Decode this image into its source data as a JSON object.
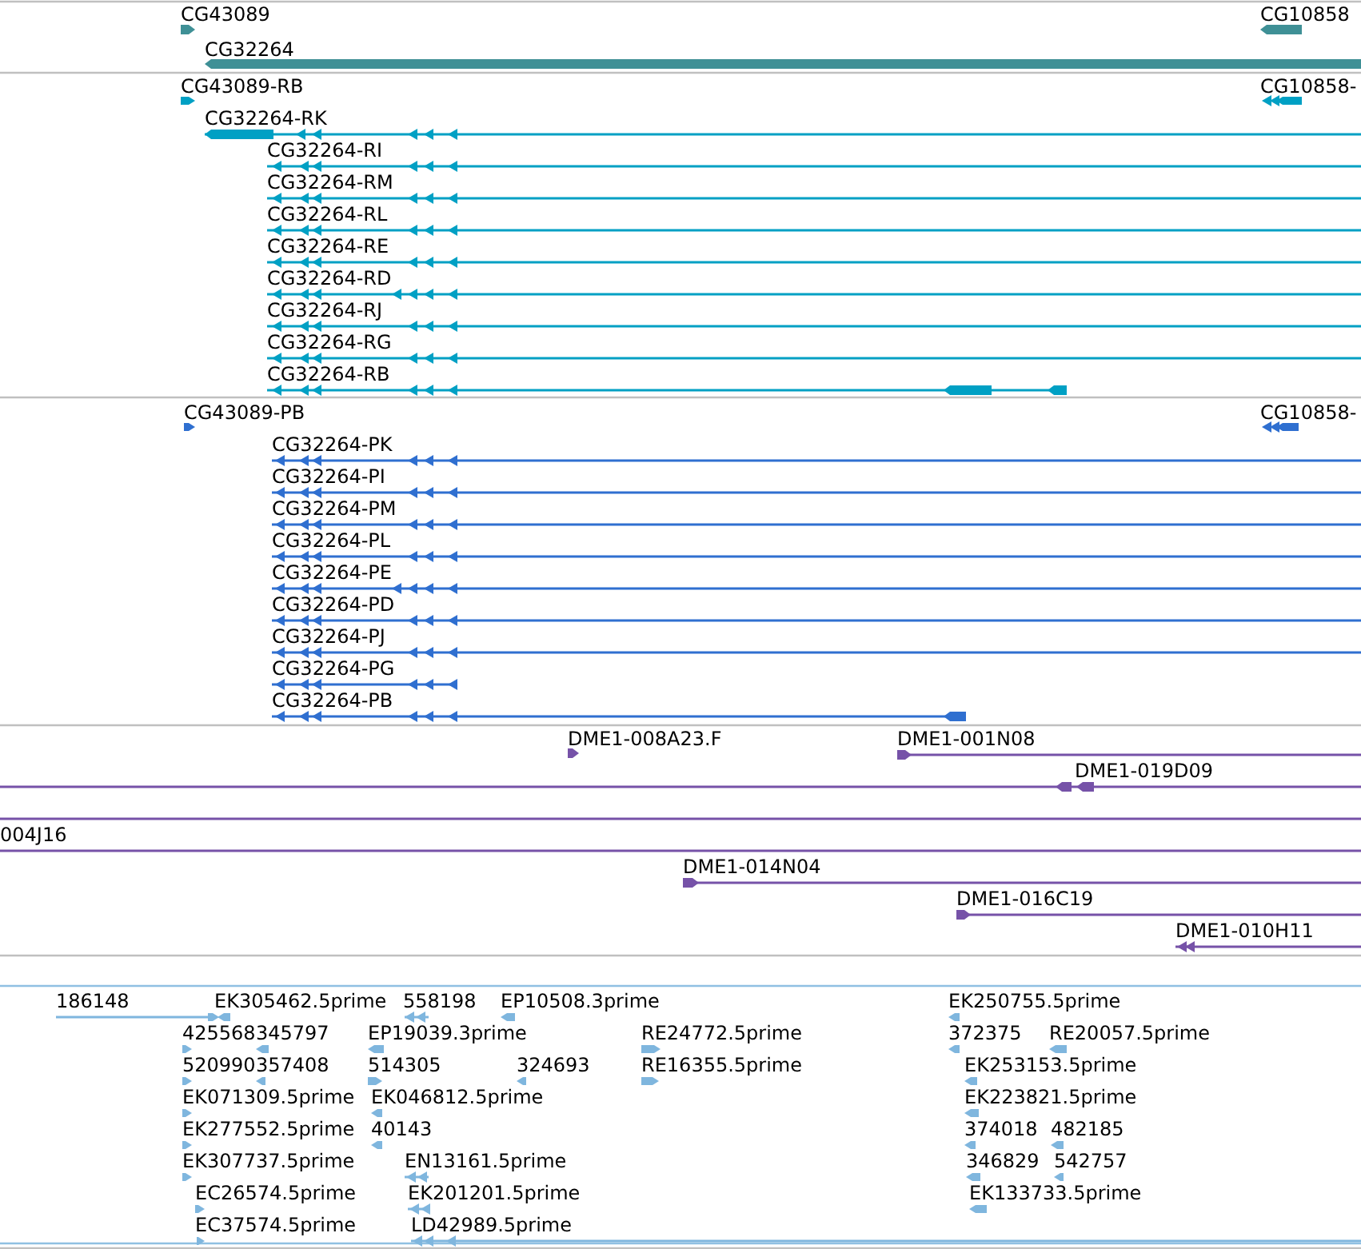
{
  "tracks": [
    {
      "kind": "gene",
      "features": [
        {
          "label": "CG43089",
          "reverse": false
        },
        {
          "label": "CG10858",
          "reverse": true
        },
        {
          "label": "CG32264",
          "reverse": true
        }
      ]
    },
    {
      "kind": "transcript",
      "features": [
        {
          "label": "CG43089-RB",
          "reverse": false
        },
        {
          "label": "CG10858-",
          "reverse": true
        },
        {
          "label": "CG32264-RK",
          "reverse": true
        },
        {
          "label": "CG32264-RI",
          "reverse": true
        },
        {
          "label": "CG32264-RM",
          "reverse": true
        },
        {
          "label": "CG32264-RL",
          "reverse": true
        },
        {
          "label": "CG32264-RE",
          "reverse": true
        },
        {
          "label": "CG32264-RD",
          "reverse": true
        },
        {
          "label": "CG32264-RJ",
          "reverse": true
        },
        {
          "label": "CG32264-RG",
          "reverse": true
        },
        {
          "label": "CG32264-RB",
          "reverse": true
        }
      ]
    },
    {
      "kind": "protein",
      "features": [
        {
          "label": "CG43089-PB",
          "reverse": false
        },
        {
          "label": "CG10858-",
          "reverse": true
        },
        {
          "label": "CG32264-PK",
          "reverse": true
        },
        {
          "label": "CG32264-PI",
          "reverse": true
        },
        {
          "label": "CG32264-PM",
          "reverse": true
        },
        {
          "label": "CG32264-PL",
          "reverse": true
        },
        {
          "label": "CG32264-PE",
          "reverse": true
        },
        {
          "label": "CG32264-PD",
          "reverse": true
        },
        {
          "label": "CG32264-PJ",
          "reverse": true
        },
        {
          "label": "CG32264-PG",
          "reverse": true
        },
        {
          "label": "CG32264-PB",
          "reverse": true
        }
      ]
    },
    {
      "kind": "clone",
      "features": [
        {
          "label": "DME1-008A23.F",
          "reverse": false
        },
        {
          "label": "DME1-001N08",
          "reverse": false
        },
        {
          "label": "DME1-019D09",
          "reverse": true
        },
        {
          "label": "004J16"
        },
        {
          "label": "DME1-014N04",
          "reverse": false
        },
        {
          "label": "DME1-016C19",
          "reverse": false
        },
        {
          "label": "DME1-010H11",
          "reverse": true
        }
      ]
    },
    {
      "kind": "est",
      "features": [
        {
          "label": "186148",
          "reverse": false
        },
        {
          "label": "EK305462.5prime",
          "reverse": true
        },
        {
          "label": "558198",
          "reverse": true
        },
        {
          "label": "EP10508.3prime",
          "reverse": true
        },
        {
          "label": "EK250755.5prime",
          "reverse": true
        },
        {
          "label": "425568",
          "reverse": false
        },
        {
          "label": "345797",
          "reverse": true
        },
        {
          "label": "EP19039.3prime",
          "reverse": true
        },
        {
          "label": "RE24772.5prime",
          "reverse": false
        },
        {
          "label": "372375",
          "reverse": true
        },
        {
          "label": "RE20057.5prime",
          "reverse": true
        },
        {
          "label": "520990",
          "reverse": false
        },
        {
          "label": "357408",
          "reverse": true
        },
        {
          "label": "514305",
          "reverse": false
        },
        {
          "label": "324693",
          "reverse": true
        },
        {
          "label": "RE16355.5prime",
          "reverse": false
        },
        {
          "label": "EK253153.5prime",
          "reverse": true
        },
        {
          "label": "EK071309.5prime",
          "reverse": false
        },
        {
          "label": "EK046812.5prime",
          "reverse": true
        },
        {
          "label": "EK223821.5prime",
          "reverse": true
        },
        {
          "label": "EK277552.5prime",
          "reverse": false
        },
        {
          "label": "40143",
          "reverse": true
        },
        {
          "label": "374018",
          "reverse": true
        },
        {
          "label": "482185",
          "reverse": true
        },
        {
          "label": "EK307737.5prime",
          "reverse": false
        },
        {
          "label": "EN13161.5prime",
          "reverse": true
        },
        {
          "label": "346829",
          "reverse": true
        },
        {
          "label": "542757",
          "reverse": true
        },
        {
          "label": "EC26574.5prime",
          "reverse": false
        },
        {
          "label": "EK201201.5prime",
          "reverse": true
        },
        {
          "label": "EK133733.5prime",
          "reverse": true
        },
        {
          "label": "EC37574.5prime",
          "reverse": false
        },
        {
          "label": "LD42989.5prime",
          "reverse": true
        }
      ]
    }
  ]
}
